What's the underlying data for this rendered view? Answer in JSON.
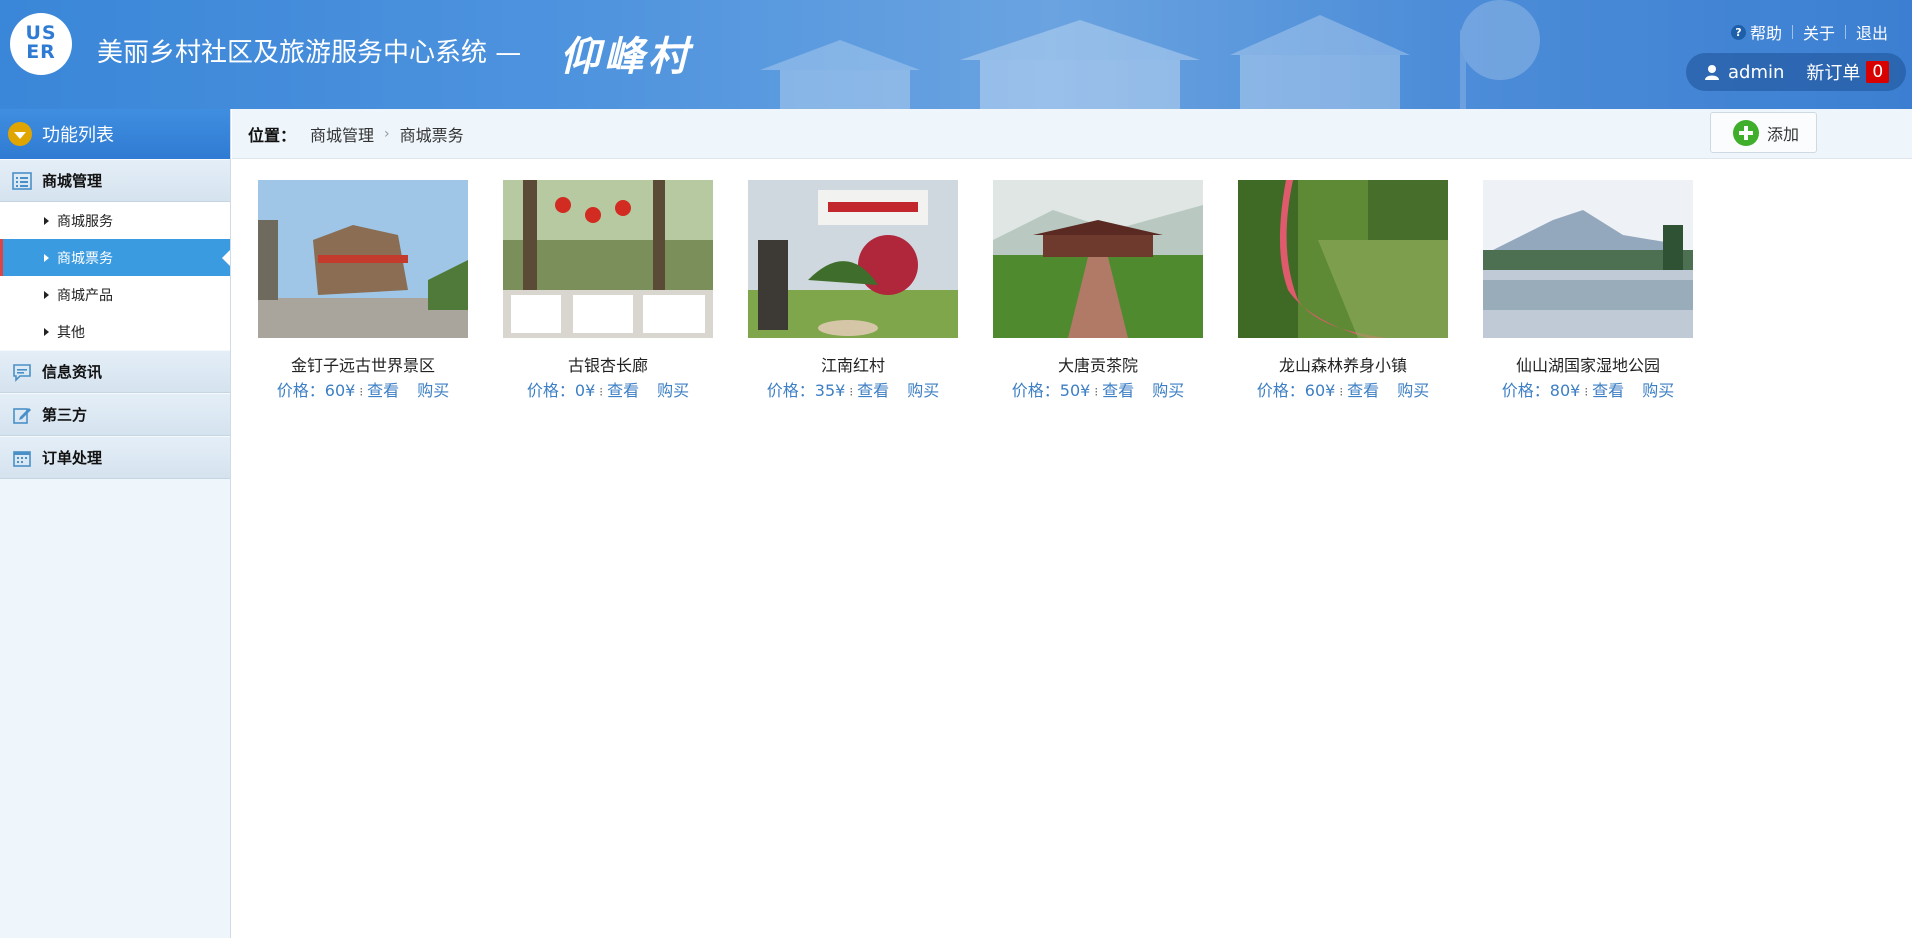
{
  "header": {
    "logo_text": "US\nER",
    "title": "美丽乡村社区及旅游服务中心系统 —",
    "village": "仰峰村",
    "links": {
      "help": "帮助",
      "about": "关于",
      "logout": "退出"
    },
    "user": {
      "name": "admin",
      "new_orders_label": "新订单",
      "new_orders_count": "0"
    }
  },
  "sidebar": {
    "heading": "功能列表",
    "groups": [
      {
        "label": "商城管理",
        "icon": "list-icon",
        "items": [
          {
            "label": "商城服务",
            "active": false
          },
          {
            "label": "商城票务",
            "active": true
          },
          {
            "label": "商城产品",
            "active": false
          },
          {
            "label": "其他",
            "active": false
          }
        ]
      },
      {
        "label": "信息资讯",
        "icon": "chat-icon"
      },
      {
        "label": "第三方",
        "icon": "edit-icon"
      },
      {
        "label": "订单处理",
        "icon": "calendar-icon"
      }
    ]
  },
  "breadcrumb": {
    "label": "位置：",
    "items": [
      "商城管理",
      "商城票务"
    ]
  },
  "toolbar": {
    "add_label": "添加"
  },
  "tickets": [
    {
      "name": "金钉子远古世界景区",
      "price_label": "价格：",
      "price": "60¥",
      "view": "查看",
      "buy": "购买"
    },
    {
      "name": "古银杏长廊",
      "price_label": "价格：",
      "price": "0¥",
      "view": "查看",
      "buy": "购买"
    },
    {
      "name": "江南红村",
      "price_label": "价格：",
      "price": "35¥",
      "view": "查看",
      "buy": "购买"
    },
    {
      "name": "大唐贡茶院",
      "price_label": "价格：",
      "price": "50¥",
      "view": "查看",
      "buy": "购买"
    },
    {
      "name": "龙山森林养身小镇",
      "price_label": "价格：",
      "price": "60¥",
      "view": "查看",
      "buy": "购买"
    },
    {
      "name": "仙山湖国家湿地公园",
      "price_label": "价格：",
      "price": "80¥",
      "view": "查看",
      "buy": "购买"
    }
  ],
  "colors": {
    "header_blue": "#3a86d8",
    "active_item": "#3b9be0",
    "link_blue": "#3d7fc4",
    "badge_red": "#d90000"
  }
}
